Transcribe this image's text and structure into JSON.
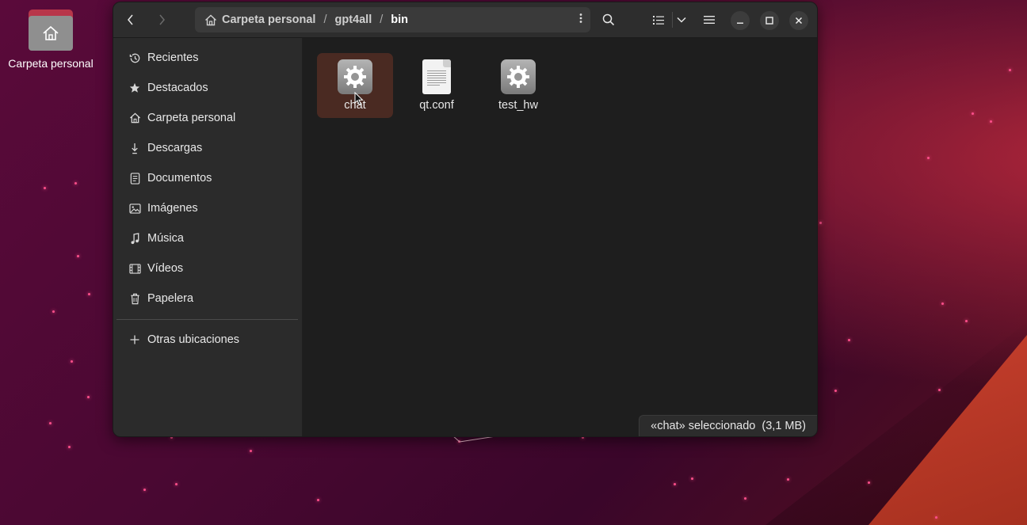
{
  "desktop": {
    "home_icon_label": "Carpeta personal"
  },
  "window": {
    "path": {
      "segments": [
        "Carpeta personal",
        "gpt4all",
        "bin"
      ],
      "separator": "/"
    },
    "sidebar": {
      "items": [
        {
          "label": "Recientes",
          "icon": "clock-icon"
        },
        {
          "label": "Destacados",
          "icon": "star-icon"
        },
        {
          "label": "Carpeta personal",
          "icon": "home-icon"
        },
        {
          "label": "Descargas",
          "icon": "download-icon"
        },
        {
          "label": "Documentos",
          "icon": "document-icon"
        },
        {
          "label": "Imágenes",
          "icon": "image-icon"
        },
        {
          "label": "Música",
          "icon": "music-icon"
        },
        {
          "label": "Vídeos",
          "icon": "video-icon"
        },
        {
          "label": "Papelera",
          "icon": "trash-icon"
        }
      ],
      "other_locations": "Otras ubicaciones"
    },
    "files": [
      {
        "name": "chat",
        "icon": "executable-gear-icon",
        "selected": true
      },
      {
        "name": "qt.conf",
        "icon": "text-file-icon",
        "selected": false
      },
      {
        "name": "test_hw",
        "icon": "executable-gear-icon",
        "selected": false
      }
    ],
    "status": "«chat» seleccionado  (3,1 MB)"
  },
  "colors": {
    "accent_selection": "#4a2a22",
    "window_bg": "#242424",
    "sidebar_bg": "#2b2b2b"
  }
}
